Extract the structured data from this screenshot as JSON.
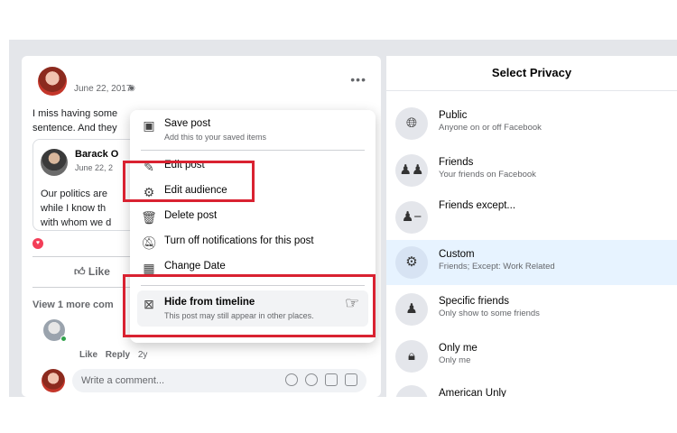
{
  "post": {
    "date": "June 22, 2017",
    "text_line1": "I miss having some",
    "text_line2": "sentence. And they",
    "shared": {
      "name": "Barack O",
      "date": "June 22, 2",
      "body_line1": "Our politics are",
      "body_line2": "while I know th",
      "body_line3": "with whom we d"
    },
    "like_label": "Like",
    "view_more": "View 1 more com",
    "comment_like": "Like",
    "comment_reply": "Reply",
    "comment_age": "2y",
    "write_placeholder": "Write a comment..."
  },
  "menu": {
    "items": [
      {
        "label": "Save post",
        "sub": "Add this to your saved items",
        "icon": "bookmark-icon"
      },
      {
        "label": "Edit post",
        "icon": "pencil-icon"
      },
      {
        "label": "Edit audience",
        "icon": "gear-icon"
      },
      {
        "label": "Delete post",
        "icon": "trash-icon"
      },
      {
        "label": "Turn off notifications for this post",
        "icon": "bell-off-icon"
      },
      {
        "label": "Change Date",
        "icon": "calendar-icon"
      },
      {
        "label": "Hide from timeline",
        "sub": "This post may still appear in other places.",
        "icon": "x-box-icon"
      }
    ]
  },
  "privacy": {
    "title": "Select Privacy",
    "options": [
      {
        "label": "Public",
        "sub": "Anyone on or off Facebook",
        "icon": "globe-icon"
      },
      {
        "label": "Friends",
        "sub": "Your friends on Facebook",
        "icon": "friends-icon"
      },
      {
        "label": "Friends except...",
        "sub": "",
        "icon": "friends-except-icon"
      },
      {
        "label": "Custom",
        "sub": "Friends; Except: Work Related",
        "icon": "gear-icon",
        "selected": true
      },
      {
        "label": "Specific friends",
        "sub": "Only show to some friends",
        "icon": "person-icon"
      },
      {
        "label": "Only me",
        "sub": "Only me",
        "icon": "lock-icon"
      },
      {
        "label": "American Unly",
        "sub": "",
        "icon": "location-icon"
      }
    ]
  },
  "colors": {
    "highlight_red": "#d92231",
    "selected_bg": "#e7f3ff"
  }
}
